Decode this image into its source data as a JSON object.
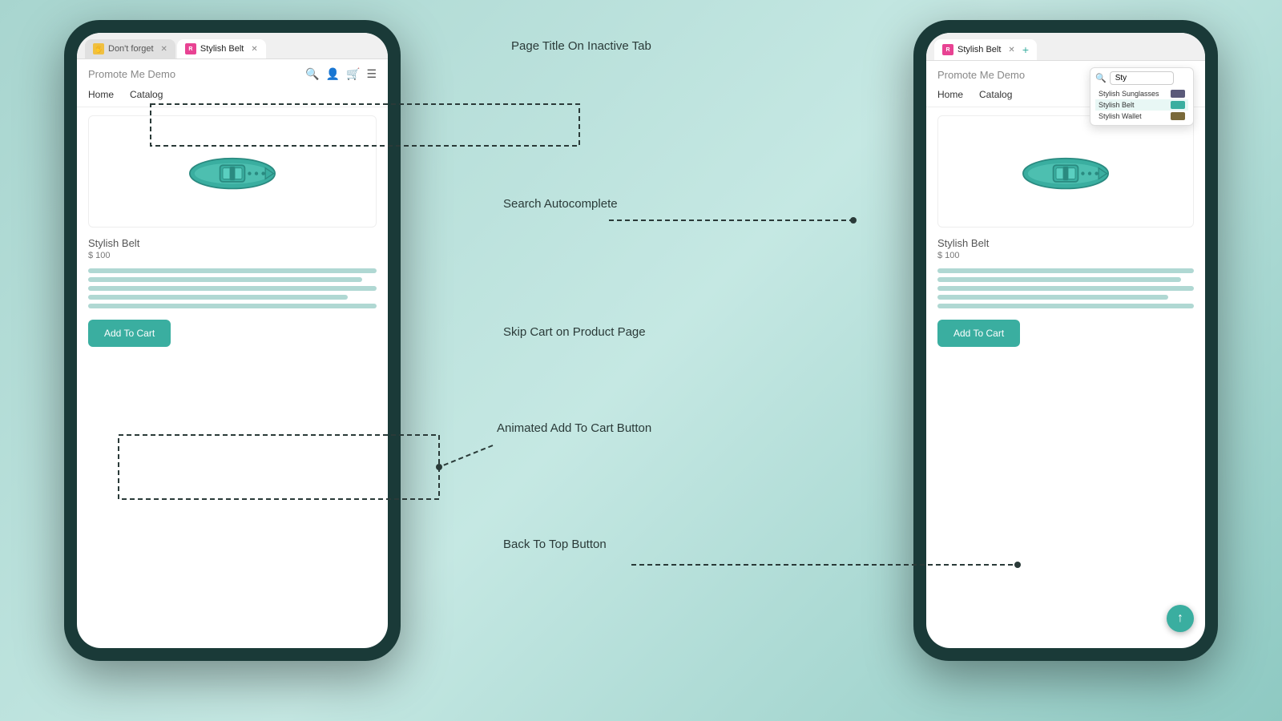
{
  "background": {
    "gradient_start": "#a8d5cf",
    "gradient_end": "#8ec9c2"
  },
  "labels": {
    "page_title_label": "Page Title On\nInactive Tab",
    "search_autocomplete_label": "Search\nAutocomplete",
    "skip_cart_label": "Skip Cart on\nProduct Page",
    "animated_add_label": "Animated Add\nTo Cart Button",
    "back_to_top_label": "Back To Top\nButton"
  },
  "left_phone": {
    "tabs": [
      {
        "label": "Don't forget",
        "active": false,
        "has_close": true,
        "icon_type": "yellow"
      },
      {
        "label": "Stylish Belt",
        "active": true,
        "has_close": true,
        "icon_type": "brand"
      }
    ],
    "site_name": "Promote Me Demo",
    "nav": [
      "Home",
      "Catalog"
    ],
    "product": {
      "name": "Stylish Belt",
      "price": "$ 100",
      "image_alt": "teal belt",
      "description_lines": 5,
      "add_to_cart_label": "Add To Cart"
    }
  },
  "right_phone": {
    "tab_label": "Stylish Belt",
    "site_name": "Promote Me Demo",
    "nav": [
      "Home",
      "Catalog"
    ],
    "search": {
      "placeholder": "Sty",
      "results": [
        {
          "label": "Stylish Sunglasses",
          "icon": "sunglasses"
        },
        {
          "label": "Stylish Belt",
          "icon": "belt",
          "highlighted": true
        },
        {
          "label": "Stylish Wallet",
          "icon": "wallet"
        }
      ]
    },
    "product": {
      "name": "Stylish Belt",
      "price": "$ 100",
      "description_lines": 5,
      "add_to_cart_label": "Add To Cart"
    },
    "back_to_top_icon": "↑"
  }
}
